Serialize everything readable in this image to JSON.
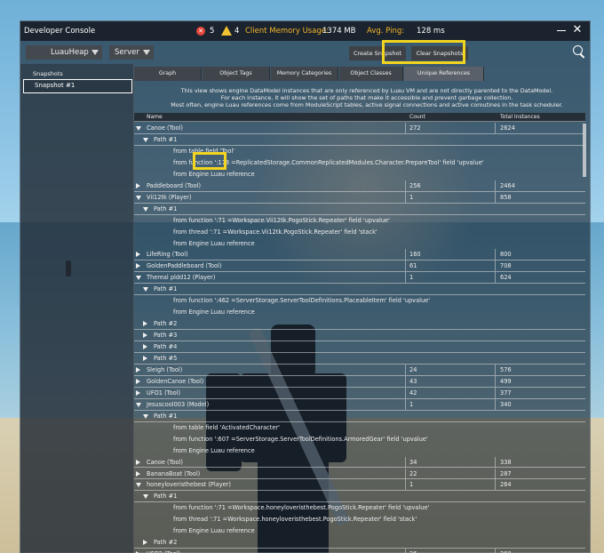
{
  "window": {
    "title": "Developer Console",
    "error_count": "5",
    "warning_count": "4",
    "memory_label": "Client Memory Usage:",
    "memory_value": "1374 MB",
    "ping_label": "Avg. Ping:",
    "ping_value": "128 ms"
  },
  "toolbar": {
    "heap_select": "LuauHeap",
    "server_select": "Server",
    "create_snapshot": "Create Snapshot",
    "clear_snapshots": "Clear Snapshots"
  },
  "snapshots": {
    "header": "Snapshots",
    "items": [
      "Snapshot #1"
    ]
  },
  "tabs": [
    "Graph",
    "Object Tags",
    "Memory Categories",
    "Object Classes",
    "Unique References"
  ],
  "active_tab": "Unique References",
  "description": [
    "This view shows engine DataModel instances that are only referenced by Luau VM and are not directly parented to the DataModel.",
    "For each instance, it will show the set of paths that make it accessible and prevent garbage collection.",
    "Most often, engine Luau references come from ModuleScript tables, active signal connections and active coroutines in the task scheduler."
  ],
  "columns": {
    "name": "Name",
    "count": "Count",
    "total": "Total Instances"
  },
  "rows": [
    {
      "level": 0,
      "arrow": "down",
      "name": "Canoe (Tool)",
      "count": "272",
      "total": "2624"
    },
    {
      "level": 1,
      "arrow": "down",
      "name": "Path #1"
    },
    {
      "level": 2,
      "name": "from table field 'Tool'"
    },
    {
      "level": 2,
      "name": "from function ':178 =ReplicatedStorage.CommonReplicatedModules.Character.PrepareTool' field 'upvalue'"
    },
    {
      "level": 2,
      "name": "from Engine Luau reference"
    },
    {
      "level": 0,
      "arrow": "right",
      "name": "Paddleboard (Tool)",
      "count": "256",
      "total": "2464"
    },
    {
      "level": 0,
      "arrow": "down",
      "name": "Vii12tk (Player)",
      "count": "1",
      "total": "858"
    },
    {
      "level": 1,
      "arrow": "down",
      "name": "Path #1"
    },
    {
      "level": 2,
      "name": "from function ':71 =Workspace.Vii12tk.PogoStick.Repeater' field 'upvalue'"
    },
    {
      "level": 2,
      "name": "from thread ':71 =Workspace.Vii12tk.PogoStick.Repeater' field 'stack'"
    },
    {
      "level": 2,
      "name": "from Engine Luau reference"
    },
    {
      "level": 0,
      "arrow": "right",
      "name": "LifeRing (Tool)",
      "count": "160",
      "total": "800"
    },
    {
      "level": 0,
      "arrow": "right",
      "name": "GoldenPaddleboard (Tool)",
      "count": "61",
      "total": "708"
    },
    {
      "level": 0,
      "arrow": "down",
      "name": "Thereal pldd12 (Player)",
      "count": "1",
      "total": "624"
    },
    {
      "level": 1,
      "arrow": "down",
      "name": "Path #1"
    },
    {
      "level": 2,
      "name": "from function ':462 =ServerStorage.ServerToolDefinitions.PlaceableItem' field 'upvalue'"
    },
    {
      "level": 2,
      "name": "from Engine Luau reference"
    },
    {
      "level": 1,
      "arrow": "right",
      "name": "Path #2"
    },
    {
      "level": 1,
      "arrow": "right",
      "name": "Path #3"
    },
    {
      "level": 1,
      "arrow": "right",
      "name": "Path #4"
    },
    {
      "level": 1,
      "arrow": "right",
      "name": "Path #5"
    },
    {
      "level": 0,
      "arrow": "right",
      "name": "Sleigh (Tool)",
      "count": "24",
      "total": "576"
    },
    {
      "level": 0,
      "arrow": "right",
      "name": "GoldenCanoe (Tool)",
      "count": "43",
      "total": "499"
    },
    {
      "level": 0,
      "arrow": "right",
      "name": "UFO1 (Tool)",
      "count": "42",
      "total": "377"
    },
    {
      "level": 0,
      "arrow": "down",
      "name": "Jesuscool003 (Model)",
      "count": "1",
      "total": "340"
    },
    {
      "level": 1,
      "arrow": "down",
      "name": "Path #1"
    },
    {
      "level": 2,
      "name": "from table field 'ActivatedCharacter'"
    },
    {
      "level": 2,
      "name": "from function ':607 =ServerStorage.ServerToolDefinitions.ArmoredGear' field 'upvalue'"
    },
    {
      "level": 2,
      "name": "from Engine Luau reference"
    },
    {
      "level": 0,
      "arrow": "right",
      "name": "Canoe (Tool)",
      "count": "34",
      "total": "338"
    },
    {
      "level": 0,
      "arrow": "right",
      "name": "BananaBoat (Tool)",
      "count": "22",
      "total": "287"
    },
    {
      "level": 0,
      "arrow": "down",
      "name": "honeyloveristhebest (Player)",
      "count": "1",
      "total": "264"
    },
    {
      "level": 1,
      "arrow": "down",
      "name": "Path #1"
    },
    {
      "level": 2,
      "name": "from function ':71 =Workspace.honeyloveristhebest.PogoStick.Repeater' field 'upvalue'"
    },
    {
      "level": 2,
      "name": "from thread ':71 =Workspace.honeyloveristhebest.PogoStick.Repeater' field 'stack'"
    },
    {
      "level": 2,
      "name": "from Engine Luau reference"
    },
    {
      "level": 1,
      "arrow": "right",
      "name": "Path #2"
    },
    {
      "level": 0,
      "arrow": "right",
      "name": "UFO2 (Tool)",
      "count": "26",
      "total": "260"
    }
  ]
}
